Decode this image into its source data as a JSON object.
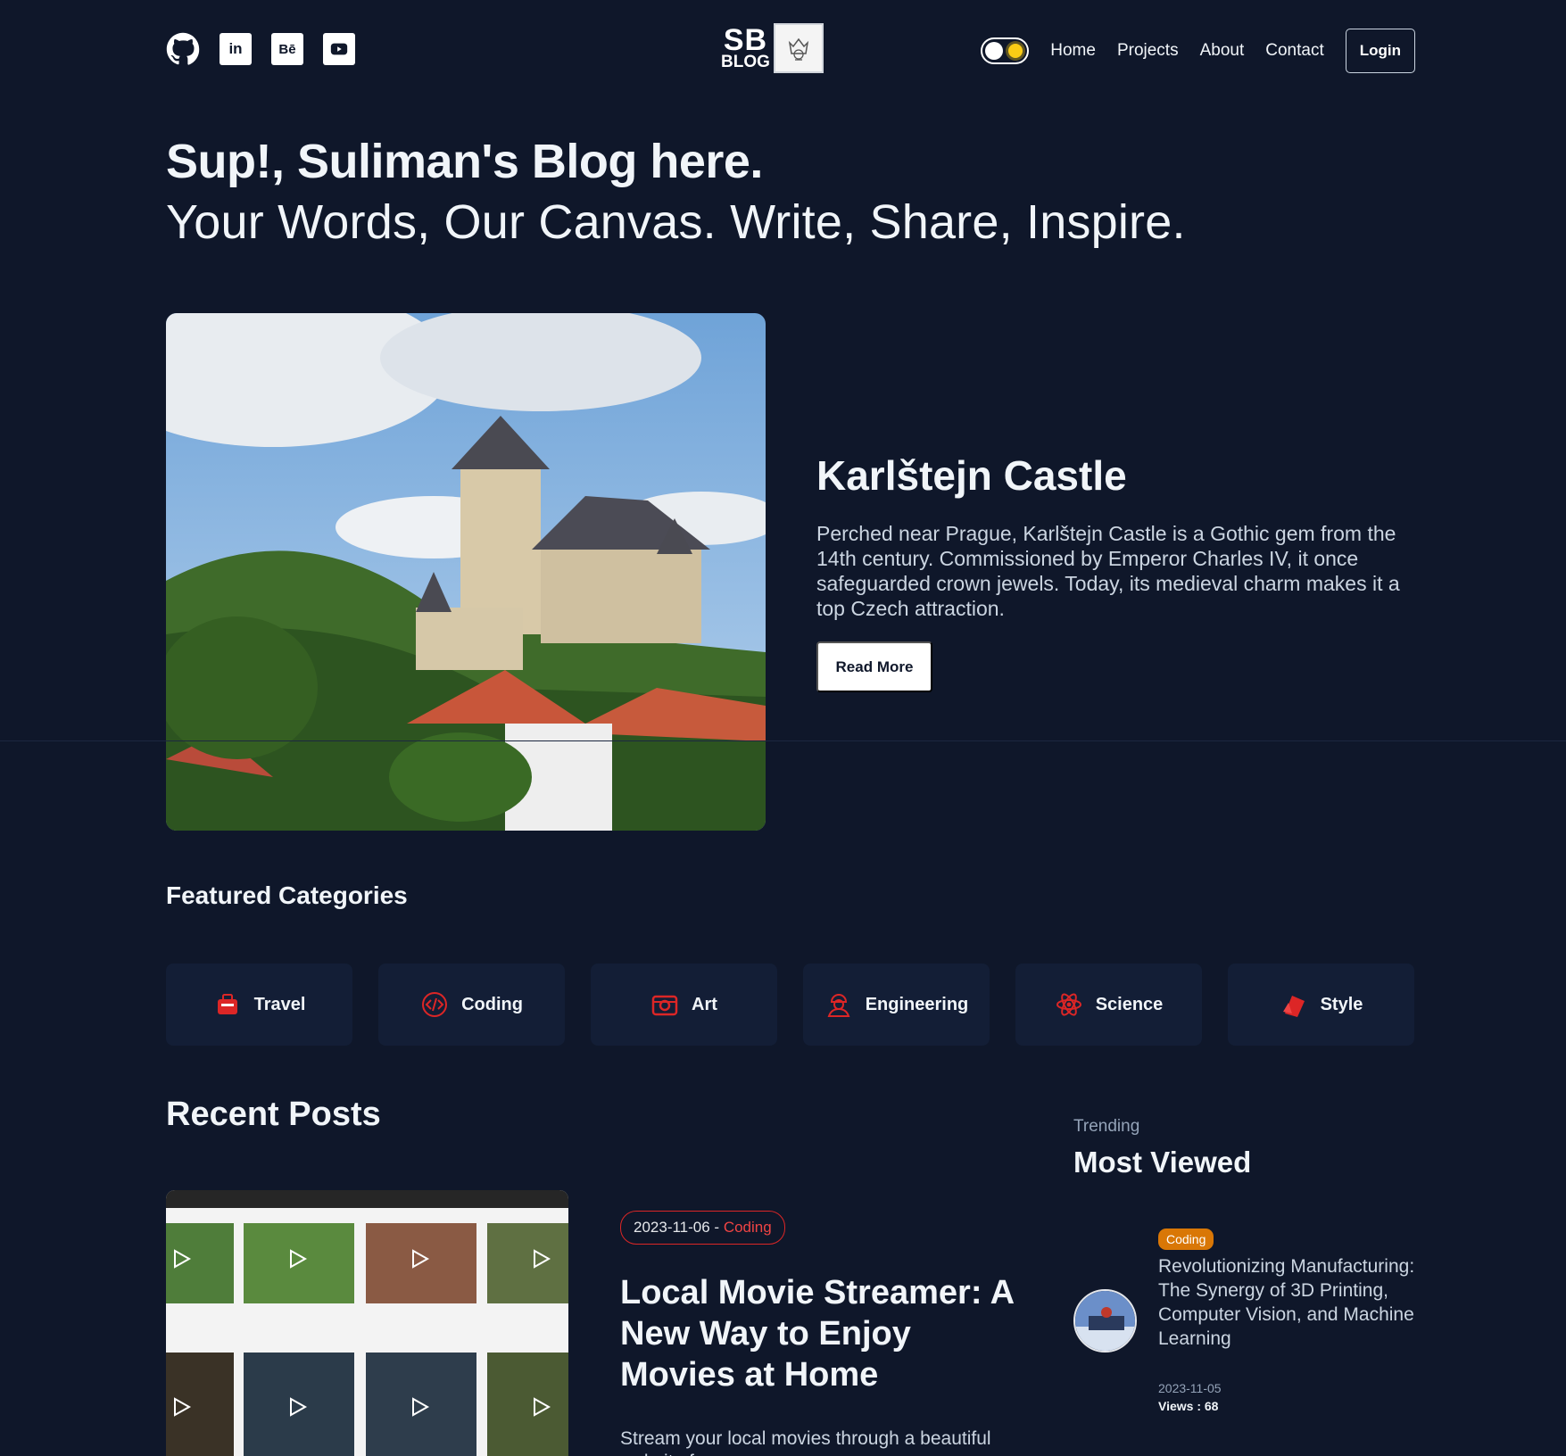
{
  "header": {
    "logo_top": "SB",
    "logo_bottom": "BLOG",
    "social": [
      {
        "name": "github-icon",
        "label": ""
      },
      {
        "name": "linkedin-icon",
        "label": "in"
      },
      {
        "name": "behance-icon",
        "label": "Bē"
      },
      {
        "name": "youtube-icon",
        "label": ""
      }
    ],
    "nav": {
      "home": "Home",
      "projects": "Projects",
      "about": "About",
      "contact": "Contact",
      "login": "Login"
    }
  },
  "hero": {
    "title": "Sup!, Suliman's Blog here.",
    "subtitle": "Your Words, Our Canvas. Write, Share, Inspire."
  },
  "featured": {
    "title": "Karlštejn Castle",
    "description": "Perched near Prague, Karlštejn Castle is a Gothic gem from the 14th century. Commissioned by Emperor Charles IV, it once safeguarded crown jewels. Today, its medieval charm makes it a top Czech attraction.",
    "button": "Read More"
  },
  "categories": {
    "heading": "Featured Categories",
    "items": [
      {
        "label": "Travel",
        "icon": "suitcase-icon"
      },
      {
        "label": "Coding",
        "icon": "code-icon"
      },
      {
        "label": "Art",
        "icon": "camera-icon"
      },
      {
        "label": "Engineering",
        "icon": "engineer-icon"
      },
      {
        "label": "Science",
        "icon": "atom-icon"
      },
      {
        "label": "Style",
        "icon": "swatch-icon"
      }
    ],
    "accent": "#dc2626"
  },
  "recent": {
    "heading": "Recent Posts",
    "post": {
      "date": "2023-11-06",
      "separator": " - ",
      "category": "Coding",
      "title": "Local Movie Streamer: A New Way to Enjoy Movies at Home",
      "description": "Stream your local movies through a beautiful website f..."
    }
  },
  "trending": {
    "label": "Trending",
    "heading": "Most Viewed",
    "item": {
      "tag": "Coding",
      "title": "Revolutionizing Manufacturing: The Synergy of 3D Printing, Computer Vision, and Machine Learning",
      "date": "2023-11-05",
      "views": "Views : 68"
    }
  }
}
